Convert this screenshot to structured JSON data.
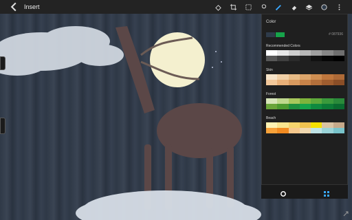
{
  "topbar": {
    "back_icon": "chevron-left-icon",
    "title": "Insert",
    "tools": [
      {
        "name": "fill-icon"
      },
      {
        "name": "crop-icon"
      },
      {
        "name": "select-icon"
      },
      {
        "name": "lasso-icon"
      },
      {
        "name": "brush-icon",
        "active": true
      },
      {
        "name": "eraser-icon"
      },
      {
        "name": "layers-icon"
      },
      {
        "name": "color-icon"
      },
      {
        "name": "more-icon"
      }
    ]
  },
  "panel": {
    "title": "Color",
    "current_color": "#2e3b4a",
    "previous_color": "#16a34a",
    "hex": "# 087936",
    "sections": [
      {
        "label": "Recommended Colors",
        "colors": [
          "#ffffff",
          "#e7e7e7",
          "#cfcfcf",
          "#b7b7b7",
          "#9f9f9f",
          "#878787",
          "#6f6f6f",
          "#575757",
          "#3f3f3f",
          "#2b2b2b",
          "#1f1f1f",
          "#111111",
          "#070707",
          "#000000"
        ]
      },
      {
        "label": "Skin",
        "colors": [
          "#f6e3c8",
          "#f1d0a6",
          "#e7bb86",
          "#dca56b",
          "#cf8e51",
          "#c0773d",
          "#ae6a37",
          "#f3c89a",
          "#e9b078",
          "#d99a5f",
          "#c88349",
          "#b36f3b",
          "#9f5d2f",
          "#8a4e27"
        ]
      },
      {
        "label": "Forest",
        "colors": [
          "#d8e6b9",
          "#bfd88d",
          "#a8c85c",
          "#7fb43c",
          "#5ea93b",
          "#3a9a3c",
          "#2a8a3a",
          "#6aa53a",
          "#4c9a30",
          "#1e8f3e",
          "#16a34a",
          "#0f8a3f",
          "#0c7a36",
          "#0a6a2f"
        ]
      },
      {
        "label": "Beach",
        "colors": [
          "#fff3b3",
          "#f9e58f",
          "#f5d46d",
          "#f0c24f",
          "#f4e100",
          "#d9c3a3",
          "#c5a98a",
          "#f7a23a",
          "#f28b21",
          "#f6c88d",
          "#f0d8b0",
          "#bfe3e6",
          "#9ad4d8",
          "#79c4cb"
        ]
      }
    ],
    "bottom_left_icon": "circle-icon",
    "bottom_right_icon": "grid-icon"
  },
  "expand_icon": "expand-icon"
}
